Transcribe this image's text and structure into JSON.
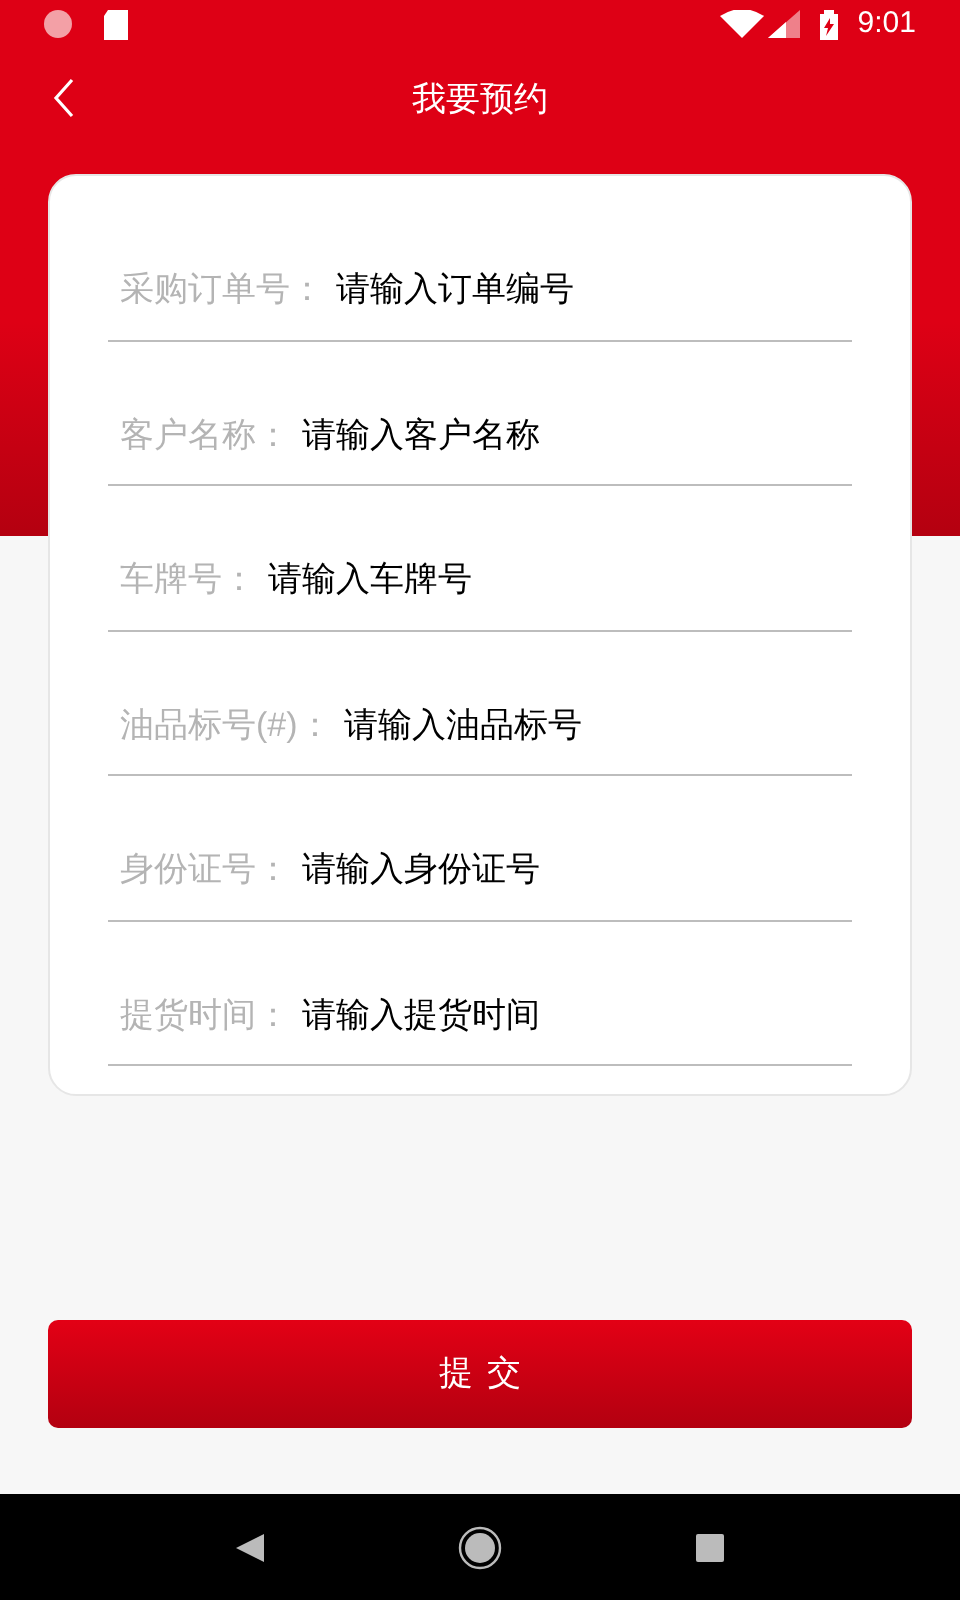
{
  "status_bar": {
    "time": "9:01"
  },
  "header": {
    "title": "我要预约"
  },
  "form": {
    "fields": [
      {
        "label": "采购订单号：",
        "placeholder": "请输入订单编号"
      },
      {
        "label": "客户名称：",
        "placeholder": "请输入客户名称"
      },
      {
        "label": "车牌号：",
        "placeholder": "请输入车牌号"
      },
      {
        "label": "油品标号(#)：",
        "placeholder": "请输入油品标号"
      },
      {
        "label": "身份证号：",
        "placeholder": "请输入身份证号"
      },
      {
        "label": "提货时间：",
        "placeholder": "请输入提货时间"
      }
    ]
  },
  "submit_button": {
    "label": "提交"
  }
}
